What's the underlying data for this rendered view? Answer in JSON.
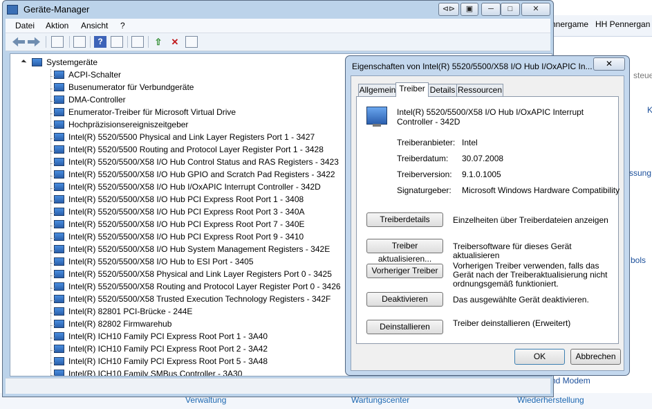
{
  "background": {
    "tabs": [
      "nnergame",
      "HH Pennergan"
    ],
    "right_texts": [
      "steue",
      "K",
      "ssung",
      "bols",
      "nd Modem"
    ],
    "bottom_links": [
      "Verwaltung",
      "Wartungscenter",
      "Wiederherstellung"
    ]
  },
  "window": {
    "title": "Geräte-Manager",
    "caption_buttons": [
      "⊲⊳",
      "▣",
      "─",
      "□",
      "✕"
    ]
  },
  "menu": [
    "Datei",
    "Aktion",
    "Ansicht",
    "?"
  ],
  "tree": {
    "root": "Systemgeräte",
    "items": [
      "ACPI-Schalter",
      "Busenumerator für Verbundgeräte",
      "DMA-Controller",
      "Enumerator-Treiber für Microsoft Virtual Drive",
      "Hochpräzisionsereigniszeitgeber",
      "Intel(R) 5520/5500 Physical and Link Layer Registers Port 1 - 3427",
      "Intel(R) 5520/5500 Routing and Protocol Layer Register Port 1 - 3428",
      "Intel(R) 5520/5500/X58 I/O Hub Control Status and RAS Registers - 3423",
      "Intel(R) 5520/5500/X58 I/O Hub GPIO and Scratch Pad Registers - 3422",
      "Intel(R) 5520/5500/X58 I/O Hub I/OxAPIC Interrupt Controller - 342D",
      "Intel(R) 5520/5500/X58 I/O Hub PCI Express Root Port 1 - 3408",
      "Intel(R) 5520/5500/X58 I/O Hub PCI Express Root Port 3 - 340A",
      "Intel(R) 5520/5500/X58 I/O Hub PCI Express Root Port 7 - 340E",
      "Intel(R) 5520/5500/X58 I/O Hub PCI Express Root Port 9 - 3410",
      "Intel(R) 5520/5500/X58 I/O Hub System Management Registers - 342E",
      "Intel(R) 5520/5500/X58 I/O Hub to ESI Port - 3405",
      "Intel(R) 5520/5500/X58 Physical and Link Layer Registers Port 0 - 3425",
      "Intel(R) 5520/5500/X58 Routing and Protocol Layer Register Port 0 - 3426",
      "Intel(R) 5520/5500/X58 Trusted Execution Technology Registers - 342F",
      "Intel(R) 82801 PCI-Brücke - 244E",
      "Intel(R) 82802 Firmwarehub",
      "Intel(R) ICH10 Family PCI Express Root Port 1 - 3A40",
      "Intel(R) ICH10 Family PCI Express Root Port 2 - 3A42",
      "Intel(R) ICH10 Family PCI Express Root Port 5 - 3A48",
      "Intel(R) ICH10 Family SMBus Controller - 3A30"
    ]
  },
  "dialog": {
    "title": "Eigenschaften von Intel(R) 5520/5500/X58 I/O Hub I/OxAPIC In...",
    "close": "✕",
    "tabs": [
      "Allgemein",
      "Treiber",
      "Details",
      "Ressourcen"
    ],
    "active_tab": "Treiber",
    "device_name": "Intel(R) 5520/5500/X58 I/O Hub I/OxAPIC Interrupt Controller - 342D",
    "props": [
      {
        "label": "Treiberanbieter:",
        "value": "Intel"
      },
      {
        "label": "Treiberdatum:",
        "value": "30.07.2008"
      },
      {
        "label": "Treiberversion:",
        "value": "9.1.0.1005"
      },
      {
        "label": "Signaturgeber:",
        "value": "Microsoft Windows Hardware Compatibility"
      }
    ],
    "actions": [
      {
        "button": "Treiberdetails",
        "desc": "Einzelheiten über Treiberdateien anzeigen"
      },
      {
        "button": "Treiber aktualisieren...",
        "desc": "Treibersoftware für dieses Gerät aktualisieren"
      },
      {
        "button": "Vorheriger Treiber",
        "desc": "Vorherigen Treiber verwenden, falls das Gerät nach der Treiberaktualisierung nicht ordnungsgemäß funktioniert."
      },
      {
        "button": "Deaktivieren",
        "desc": "Das ausgewählte Gerät deaktivieren."
      },
      {
        "button": "Deinstallieren",
        "desc": "Treiber deinstallieren (Erweitert)"
      }
    ],
    "ok": "OK",
    "cancel": "Abbrechen"
  }
}
